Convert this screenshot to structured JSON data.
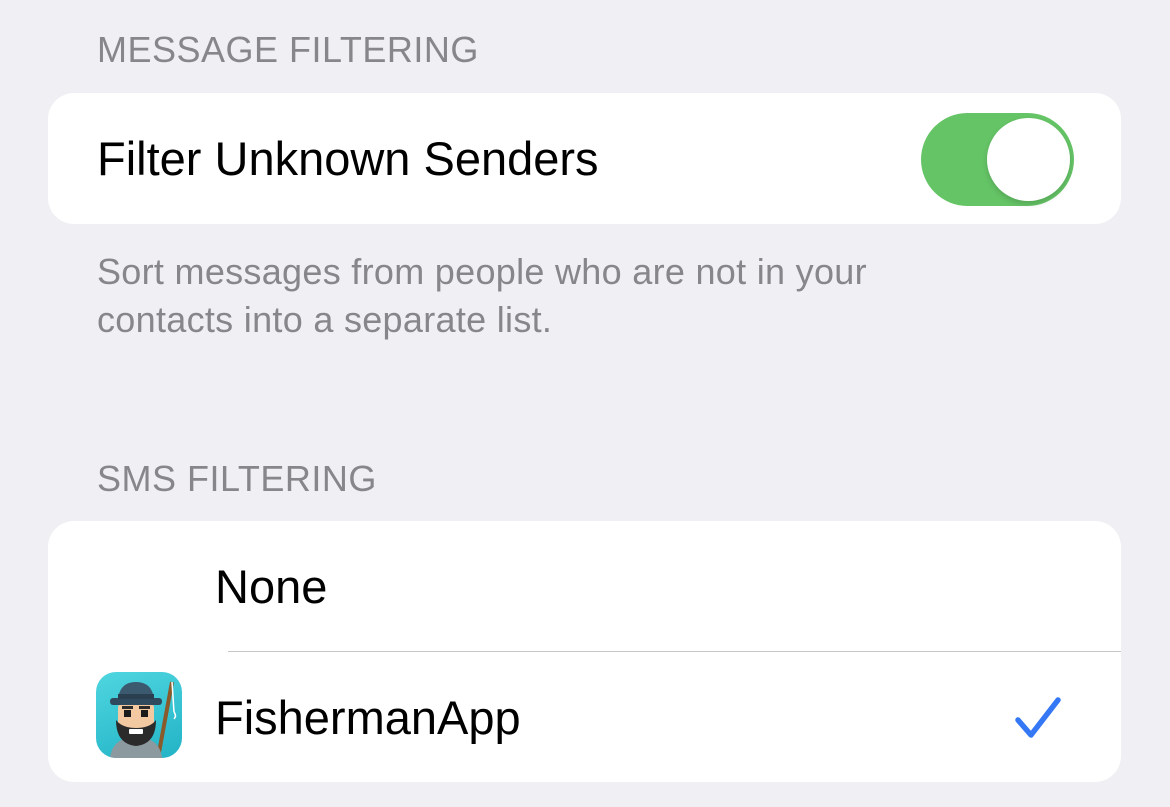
{
  "message_filtering": {
    "header": "MESSAGE FILTERING",
    "filter_unknown_label": "Filter Unknown Senders",
    "filter_unknown_on": true,
    "footer": "Sort messages from people who are not in your contacts into a separate list."
  },
  "sms_filtering": {
    "header": "SMS FILTERING",
    "options": [
      {
        "label": "None",
        "selected": false,
        "icon": null
      },
      {
        "label": "FishermanApp",
        "selected": true,
        "icon": "fisherman-app-icon"
      }
    ]
  },
  "colors": {
    "background": "#efeff4",
    "toggle_on": "#65c466",
    "checkmark": "#3478f6",
    "secondary_text": "#86868b"
  },
  "icons": {
    "check": "checkmark-icon"
  }
}
